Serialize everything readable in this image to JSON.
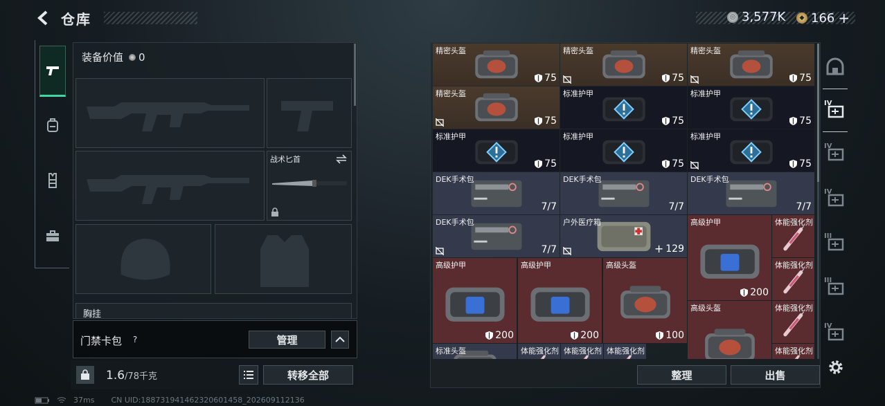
{
  "header": {
    "title": "仓库"
  },
  "currency": {
    "silver": {
      "value": "3,577K",
      "color": "#9aa3a8"
    },
    "gold": {
      "value": "166",
      "color": "#c9a65c"
    },
    "plus": "+"
  },
  "left_tabs": [
    {
      "icon": "pistol-icon",
      "active": true
    },
    {
      "icon": "backpack-icon",
      "active": false
    },
    {
      "icon": "vest-icon",
      "active": false
    },
    {
      "icon": "briefcase-icon",
      "active": false
    }
  ],
  "equipment": {
    "label": "装备价值",
    "value": "0",
    "slots": [
      {
        "name": "primary-weapon-slot",
        "label": ""
      },
      {
        "name": "sidearm-slot",
        "label": ""
      },
      {
        "name": "secondary-weapon-slot",
        "label": ""
      },
      {
        "name": "melee-slot",
        "label": "战术匕首"
      },
      {
        "name": "helmet-slot",
        "label": ""
      },
      {
        "name": "armor-slot",
        "label": ""
      }
    ],
    "chest_rig_label": "胸挂"
  },
  "keycard": {
    "label": "门禁卡包",
    "help": "?",
    "manage": "管理"
  },
  "capacity": {
    "current": "1.6",
    "max": "/78千克",
    "transfer_all": "转移全部"
  },
  "inventory": {
    "cells": [
      {
        "name": "精密头盔",
        "value": "75",
        "kind": "helmet",
        "bg": "brown",
        "broken": false
      },
      {
        "name": "精密头盔",
        "value": "75",
        "kind": "helmet",
        "bg": "brown",
        "broken": true
      },
      {
        "name": "精密头盔",
        "value": "75",
        "kind": "helmet",
        "bg": "brown",
        "broken": true
      },
      {
        "name": "精密头盔",
        "value": "75",
        "kind": "helmet",
        "bg": "brown",
        "broken": true
      },
      {
        "name": "标准护甲",
        "value": "75",
        "kind": "armor-std",
        "bg": "navy",
        "broken": false
      },
      {
        "name": "标准护甲",
        "value": "75",
        "kind": "armor-std",
        "bg": "navy",
        "broken": false
      },
      {
        "name": "标准护甲",
        "value": "75",
        "kind": "armor-std",
        "bg": "navy",
        "broken": false
      },
      {
        "name": "标准护甲",
        "value": "75",
        "kind": "armor-std",
        "bg": "navy",
        "broken": false
      },
      {
        "name": "标准护甲",
        "value": "75",
        "kind": "armor-std",
        "bg": "navy",
        "broken": true
      },
      {
        "name": "DEK手术包",
        "value": "7/7",
        "kind": "surgery",
        "bg": "slate",
        "broken": false
      },
      {
        "name": "DEK手术包",
        "value": "7/7",
        "kind": "surgery",
        "bg": "slate",
        "broken": false
      },
      {
        "name": "DEK手术包",
        "value": "7/7",
        "kind": "surgery",
        "bg": "slate",
        "broken": false
      },
      {
        "name": "DEK手术包",
        "value": "7/7",
        "kind": "surgery",
        "bg": "slate",
        "broken": true
      },
      {
        "name": "户外医疗箱",
        "value": "129",
        "kind": "medkit",
        "bg": "slate",
        "broken": true
      },
      {
        "name": "高级护甲",
        "value": "200",
        "kind": "armor-adv",
        "bg": "red",
        "broken": false
      },
      {
        "name": "体能强化剂",
        "value": "",
        "kind": "syringe",
        "bg": "red",
        "broken": false
      },
      {
        "name": "高级护甲",
        "value": "200",
        "kind": "armor-adv",
        "bg": "red",
        "broken": false
      },
      {
        "name": "高级护甲",
        "value": "200",
        "kind": "armor-adv",
        "bg": "red",
        "broken": false
      },
      {
        "name": "高级头盔",
        "value": "100",
        "kind": "helmet-adv",
        "bg": "red",
        "broken": false
      },
      {
        "name": "体能强化剂",
        "value": "",
        "kind": "syringe",
        "bg": "red",
        "broken": false
      },
      {
        "name": "高级头盔",
        "value": "",
        "kind": "helmet-adv",
        "bg": "red",
        "broken": false
      },
      {
        "name": "体能强化剂",
        "value": "",
        "kind": "syringe",
        "bg": "red",
        "broken": false
      },
      {
        "name": "标准头盔",
        "value": "",
        "kind": "helmet",
        "bg": "slate",
        "broken": false
      },
      {
        "name": "体能强化剂",
        "value": "",
        "kind": "syringe",
        "bg": "slate",
        "broken": false
      },
      {
        "name": "体能强化剂",
        "value": "",
        "kind": "syringe",
        "bg": "slate",
        "broken": false
      },
      {
        "name": "体能强化剂",
        "value": "",
        "kind": "syringe",
        "bg": "slate",
        "broken": false
      },
      {
        "name": "体能强化剂",
        "value": "",
        "kind": "syringe",
        "bg": "red",
        "broken": false
      }
    ],
    "sort": "整理",
    "sell": "出售"
  },
  "right_tabs": [
    {
      "icon": "safehouse-icon",
      "tier": ""
    },
    {
      "icon": "medical-station-icon",
      "tier": "IV"
    },
    {
      "icon": "workbench-icon",
      "tier": "IV"
    },
    {
      "icon": "armory-icon",
      "tier": "IV"
    },
    {
      "icon": "tech-center-icon",
      "tier": "III"
    },
    {
      "icon": "gym-icon",
      "tier": "III"
    },
    {
      "icon": "shooting-range-icon",
      "tier": "IV"
    }
  ],
  "status_bar": {
    "ping": "37ms",
    "uid": "CN UID:1887319414623206014​58_202609112136"
  }
}
